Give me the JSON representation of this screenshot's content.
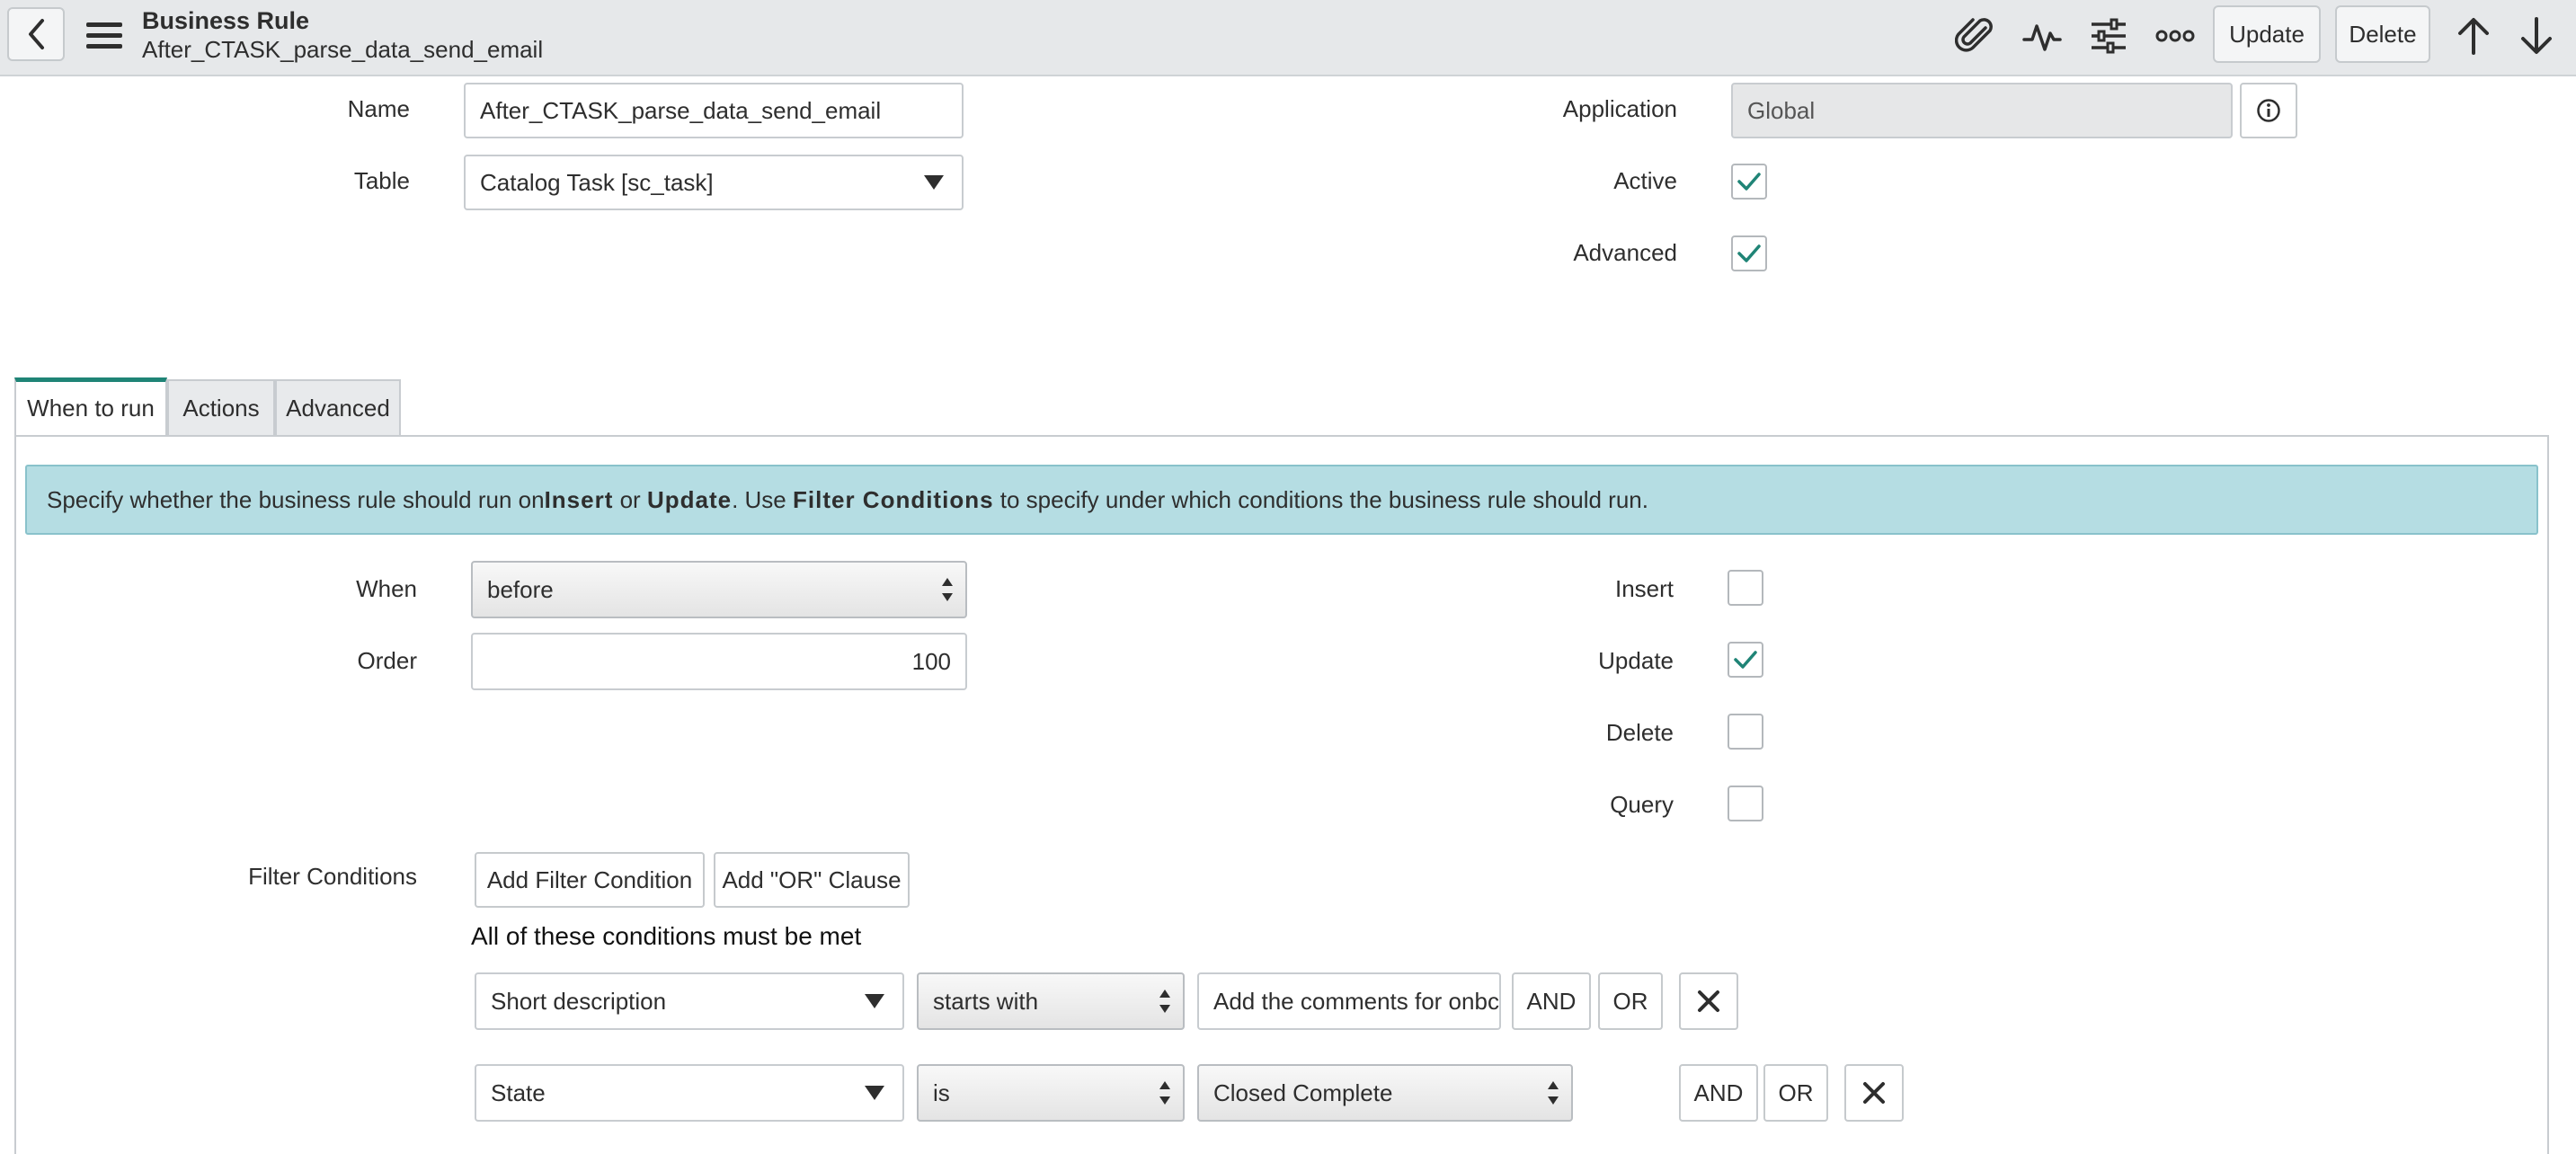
{
  "header": {
    "title": "Business Rule",
    "subtitle": "After_CTASK_parse_data_send_email",
    "update_label": "Update",
    "delete_label": "Delete"
  },
  "form": {
    "name_label": "Name",
    "name_value": "After_CTASK_parse_data_send_email",
    "table_label": "Table",
    "table_value": "Catalog Task [sc_task]",
    "application_label": "Application",
    "application_value": "Global",
    "active_label": "Active",
    "active_checked": true,
    "advanced_label": "Advanced",
    "advanced_checked": true
  },
  "tabs": [
    {
      "label": "When to run",
      "active": true
    },
    {
      "label": "Actions",
      "active": false
    },
    {
      "label": "Advanced",
      "active": false
    }
  ],
  "info": {
    "p1": "Specify whether the business rule should run on ",
    "insert": "Insert",
    "p2": " or ",
    "update": "Update",
    "p3": ". Use ",
    "filter": "Filter Conditions",
    "p4": " to specify under which conditions the business rule should run."
  },
  "when_to_run": {
    "when_label": "When",
    "when_value": "before",
    "order_label": "Order",
    "order_value": "100",
    "insert_label": "Insert",
    "insert_checked": false,
    "update_label": "Update",
    "update_checked": true,
    "delete_label": "Delete",
    "delete_checked": false,
    "query_label": "Query",
    "query_checked": false
  },
  "filter": {
    "label": "Filter Conditions",
    "add_condition": "Add Filter Condition",
    "add_or": "Add \"OR\" Clause",
    "heading": "All of these conditions must be met",
    "conditions": [
      {
        "field": "Short description",
        "operator": "starts with",
        "value": "Add the comments for onbc",
        "and": "AND",
        "or": "OR"
      },
      {
        "field": "State",
        "operator": "is",
        "value": "Closed Complete",
        "and": "AND",
        "or": "OR"
      }
    ]
  },
  "colors": {
    "accent": "#1f8476",
    "banner": "#b5dde3",
    "header": "#e6e8ea"
  }
}
